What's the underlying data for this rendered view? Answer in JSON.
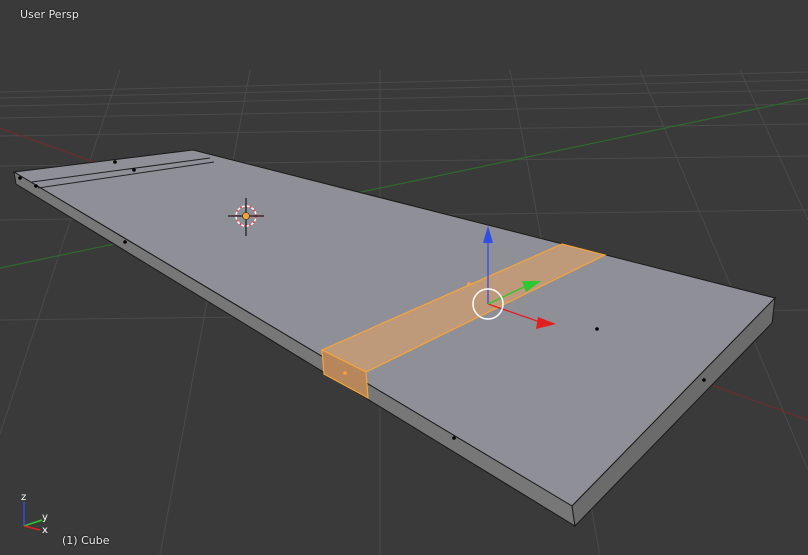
{
  "viewport": {
    "view_label": "User Persp",
    "object_label": "(1) Cube"
  },
  "axes_gizmo": {
    "z_label": "z",
    "y_label": "y",
    "x_label": "x"
  },
  "colors": {
    "background": "#3a3a3a",
    "grid": "#4a4a4a",
    "x_axis": "#e01f1f",
    "y_axis": "#29c92f",
    "z_axis": "#2f4ee6",
    "mesh_face": "#8f8f98",
    "mesh_side": "#767676",
    "selection": "#f6a43a",
    "selected_face": "#bf9a7a"
  },
  "icons": {
    "cursor": "3d-cursor-icon",
    "manipulator": "transform-manipulator-icon",
    "gizmo": "axis-gizmo-icon"
  }
}
